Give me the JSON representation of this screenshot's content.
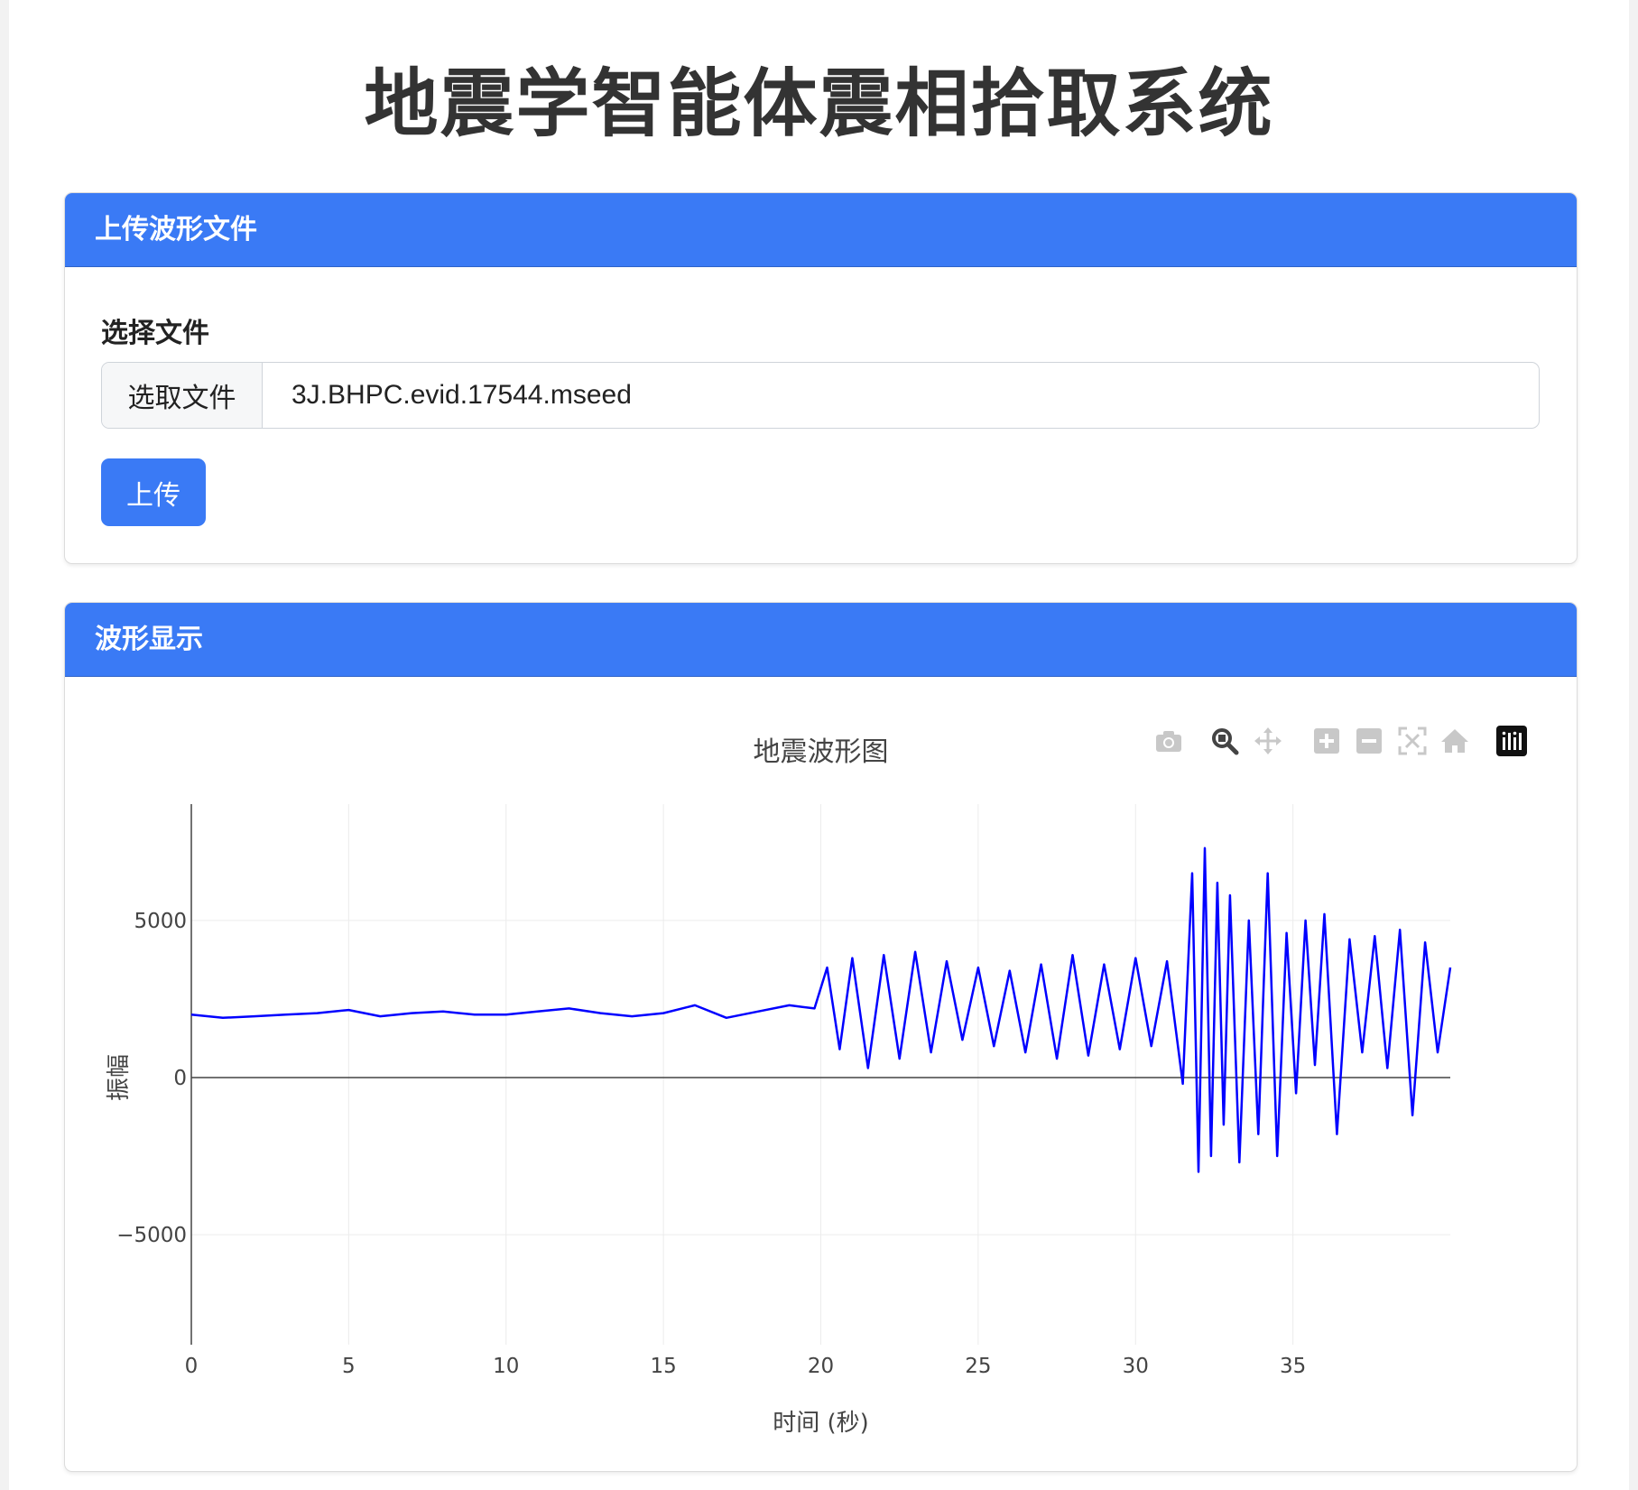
{
  "app": {
    "title": "地震学智能体震相拾取系统"
  },
  "upload": {
    "header": "上传波形文件",
    "field_label": "选择文件",
    "choose_button": "选取文件",
    "file_name": "3J.BHPC.evid.17544.mseed",
    "upload_button": "上传"
  },
  "waveform": {
    "header": "波形显示",
    "modebar": [
      "camera-icon",
      "zoom-icon",
      "pan-icon",
      "zoom-in-icon",
      "zoom-out-icon",
      "autoscale-icon",
      "home-icon",
      "plotly-logo-icon"
    ]
  },
  "chart_data": {
    "type": "line",
    "title": "地震波形图",
    "xlabel": "时间 (秒)",
    "ylabel": "振幅",
    "xlim": [
      0,
      40
    ],
    "ylim": [
      -8500,
      8700
    ],
    "xticks": [
      0,
      5,
      10,
      15,
      20,
      25,
      30,
      35
    ],
    "yticks": [
      -5000,
      0,
      5000
    ],
    "grid": true,
    "line_color": "#0000ff",
    "series": [
      {
        "x": [
          0,
          1,
          2,
          3,
          4,
          5,
          6,
          7,
          8,
          9,
          10,
          11,
          12,
          13,
          14,
          15,
          16,
          17,
          18,
          19,
          19.8,
          20.2,
          20.6,
          21.0,
          21.5,
          22.0,
          22.5,
          23.0,
          23.5,
          24.0,
          24.5,
          25.0,
          25.5,
          26.0,
          26.5,
          27.0,
          27.5,
          28.0,
          28.5,
          29.0,
          29.5,
          30.0,
          30.5,
          31.0,
          31.5,
          31.8,
          32.0,
          32.2,
          32.4,
          32.6,
          32.8,
          33.0,
          33.3,
          33.6,
          33.9,
          34.2,
          34.5,
          34.8,
          35.1,
          35.4,
          35.7,
          36.0,
          36.4,
          36.8,
          37.2,
          37.6,
          38.0,
          38.4,
          38.8,
          39.2,
          39.6,
          40.0
        ],
        "y": [
          2000,
          1900,
          1950,
          2000,
          2050,
          2150,
          1950,
          2050,
          2100,
          2000,
          2000,
          2100,
          2200,
          2050,
          1950,
          2050,
          2300,
          1900,
          2100,
          2300,
          2200,
          3500,
          900,
          3800,
          300,
          3900,
          600,
          4000,
          800,
          3700,
          1200,
          3500,
          1000,
          3400,
          800,
          3600,
          600,
          3900,
          700,
          3600,
          900,
          3800,
          1000,
          3700,
          -200,
          6500,
          -3000,
          7300,
          -2500,
          6200,
          -1500,
          5800,
          -2700,
          5000,
          -1800,
          6500,
          -2500,
          4600,
          -500,
          5000,
          400,
          5200,
          -1800,
          4400,
          800,
          4500,
          300,
          4700,
          -1200,
          4300,
          800,
          3500
        ]
      }
    ]
  }
}
